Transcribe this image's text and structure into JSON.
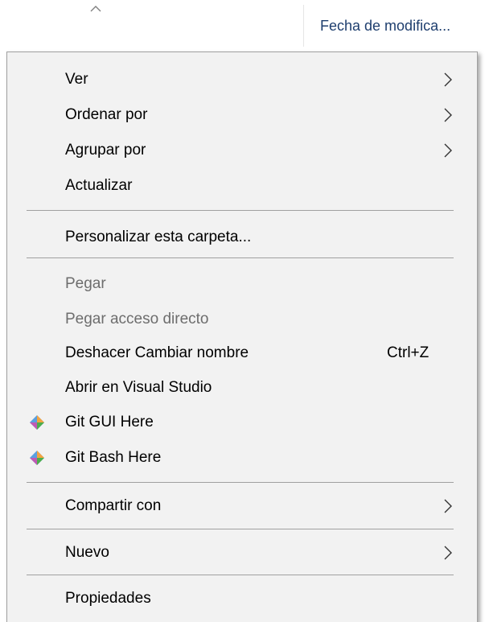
{
  "header": {
    "sort_icon": "chevron-up-icon",
    "column_label": "Fecha de modifica..."
  },
  "menu": {
    "items": [
      {
        "label": "Ver",
        "submenu": true,
        "enabled": true
      },
      {
        "label": "Ordenar por",
        "submenu": true,
        "enabled": true
      },
      {
        "label": "Agrupar por",
        "submenu": true,
        "enabled": true
      },
      {
        "label": "Actualizar",
        "submenu": false,
        "enabled": true
      },
      {
        "label": "Personalizar esta carpeta...",
        "submenu": false,
        "enabled": true
      },
      {
        "label": "Pegar",
        "submenu": false,
        "enabled": false
      },
      {
        "label": "Pegar acceso directo",
        "submenu": false,
        "enabled": false
      },
      {
        "label": "Deshacer Cambiar nombre",
        "shortcut": "Ctrl+Z",
        "submenu": false,
        "enabled": true
      },
      {
        "label": "Abrir en Visual Studio",
        "submenu": false,
        "enabled": true
      },
      {
        "label": "Git GUI Here",
        "icon": "git-icon",
        "submenu": false,
        "enabled": true
      },
      {
        "label": "Git Bash Here",
        "icon": "git-icon",
        "submenu": false,
        "enabled": true
      },
      {
        "label": "Compartir con",
        "submenu": true,
        "enabled": true
      },
      {
        "label": "Nuevo",
        "submenu": true,
        "enabled": true
      },
      {
        "label": "Propiedades",
        "submenu": false,
        "enabled": true
      }
    ]
  },
  "colors": {
    "menu_background": "#f2f2f2",
    "separator": "#a0a0a0",
    "disabled_text": "#6d6d6d",
    "header_link": "#1e3e6e"
  }
}
